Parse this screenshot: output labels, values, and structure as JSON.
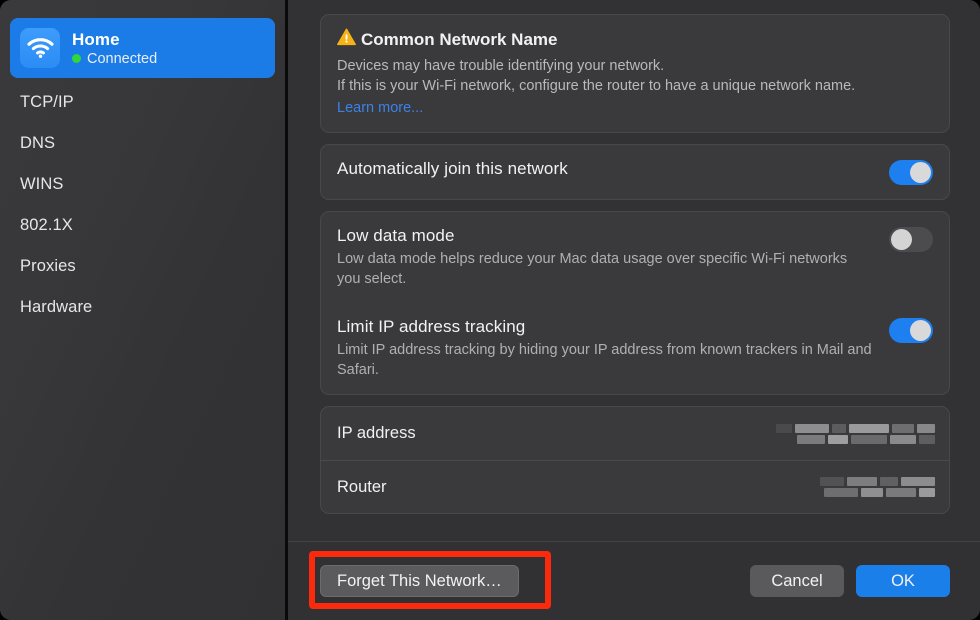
{
  "sidebar": {
    "network": {
      "icon": "wifi-icon",
      "name": "Home",
      "status": "Connected",
      "status_color": "#30d63a",
      "selected_color": "#1b7ce8"
    },
    "items": [
      {
        "label": "TCP/IP"
      },
      {
        "label": "DNS"
      },
      {
        "label": "WINS"
      },
      {
        "label": "802.1X"
      },
      {
        "label": "Proxies"
      },
      {
        "label": "Hardware"
      }
    ]
  },
  "content": {
    "warning": {
      "icon": "warning-triangle-icon",
      "title": "Common Network Name",
      "line1": "Devices may have trouble identifying your network.",
      "line2": "If this is your Wi-Fi network, configure the router to have a unique network name.",
      "link": "Learn more...",
      "link_color": "#3b82e8",
      "icon_color": "#f5b317"
    },
    "settings": [
      {
        "title": "Automatically join this network",
        "description": "",
        "toggle": "on"
      },
      {
        "title": "Low data mode",
        "description": "Low data mode helps reduce your Mac data usage over specific Wi-Fi networks you select.",
        "toggle": "off"
      },
      {
        "title": "Limit IP address tracking",
        "description": "Limit IP address tracking by hiding your IP address from known trackers in Mail and Safari.",
        "toggle": "on"
      }
    ],
    "info_rows": [
      {
        "label": "IP address",
        "value": "",
        "redacted": true
      },
      {
        "label": "Router",
        "value": "",
        "redacted": true
      }
    ]
  },
  "footer": {
    "forget_label": "Forget This Network…",
    "cancel_label": "Cancel",
    "ok_label": "OK",
    "ok_color": "#1a7fe8"
  },
  "annotation": {
    "color": "#fc2a0c",
    "target": "forget-this-network-button"
  }
}
